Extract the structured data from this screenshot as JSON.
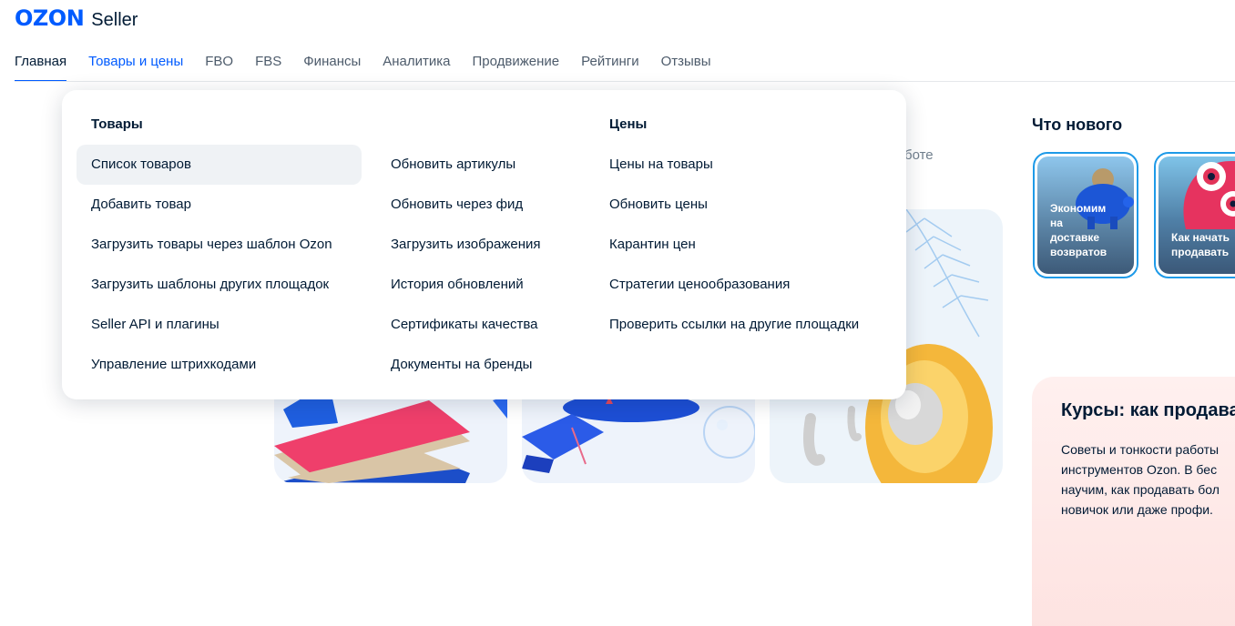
{
  "brand": {
    "logo": "OZON",
    "product": "Seller"
  },
  "nav": [
    {
      "label": "Главная",
      "state": "active"
    },
    {
      "label": "Товары и цены",
      "state": "hover"
    },
    {
      "label": "FBO",
      "state": ""
    },
    {
      "label": "FBS",
      "state": ""
    },
    {
      "label": "Финансы",
      "state": ""
    },
    {
      "label": "Аналитика",
      "state": ""
    },
    {
      "label": "Продвижение",
      "state": ""
    },
    {
      "label": "Рейтинги",
      "state": ""
    },
    {
      "label": "Отзывы",
      "state": ""
    }
  ],
  "dropdown": {
    "goods_heading": "Товары",
    "prices_heading": "Цены",
    "col1": [
      "Список товаров",
      "Добавить товар",
      "Загрузить товары через шаблон Ozon",
      "Загрузить шаблоны других площадок",
      "Seller API и плагины",
      "Управление штрихкодами"
    ],
    "col2": [
      "Обновить артикулы",
      "Обновить через фид",
      "Загрузить изображения",
      "История обновлений",
      "Сертификаты качества",
      "Документы на бренды"
    ],
    "col3": [
      "Цены на товары",
      "Обновить цены",
      "Карантин цен",
      "Стратегии ценообразования",
      "Проверить ссылки на другие площадки"
    ],
    "highlighted": "Список товаров"
  },
  "background": {
    "partial_text": "боте"
  },
  "whats_new": {
    "title": "Что нового",
    "stories": [
      {
        "lines": [
          "Экономим",
          "на",
          "доставке",
          "возвратов"
        ]
      },
      {
        "lines": [
          "Как начать",
          "продавать"
        ]
      }
    ]
  },
  "courses": {
    "title": "Курсы: как продават",
    "lines": [
      "Советы и тонкости работы",
      "инструментов Ozon. В бес",
      "научим, как продавать бол",
      "новичок или даже профи."
    ]
  },
  "colors": {
    "accent": "#005bff",
    "text": "#001a34",
    "muted": "#707f8d",
    "story_border": "#1e9ae8"
  }
}
